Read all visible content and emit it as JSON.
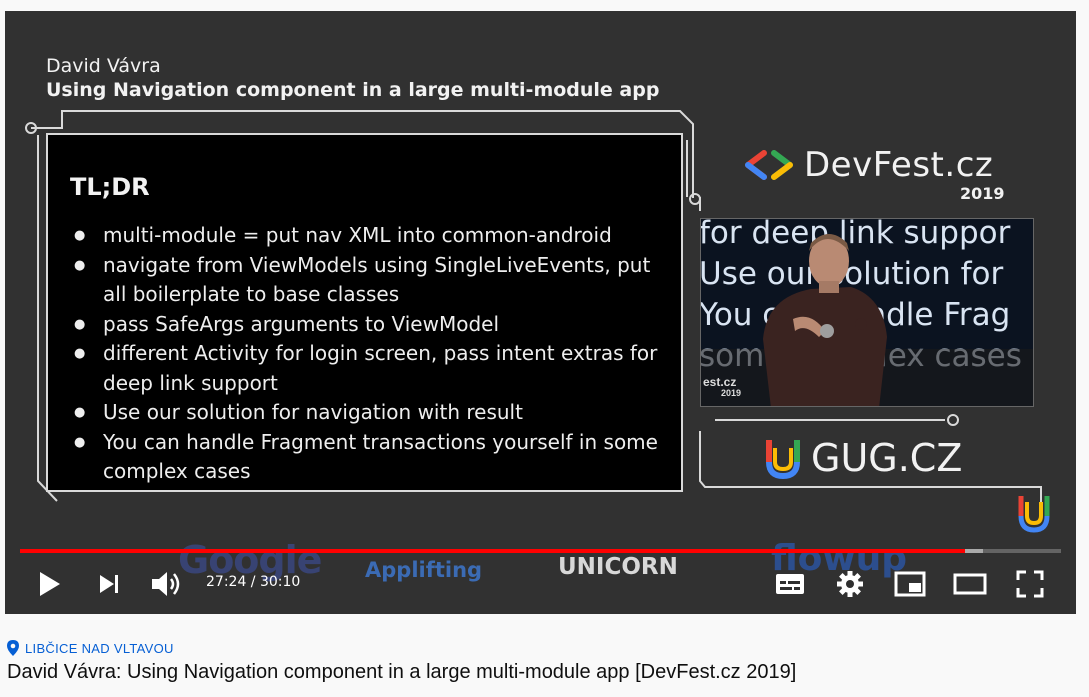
{
  "slide": {
    "speaker": "David Vávra",
    "title": "Using Navigation component in a large multi-module app",
    "tldr_heading": "TL;DR",
    "tldr_items": [
      "multi-module = put nav XML into common-android",
      "navigate from ViewModels using SingleLiveEvents, put all boilerplate to base classes",
      "pass SafeArgs arguments to ViewModel",
      "different Activity for login screen, pass intent extras for deep link support",
      "Use our solution for navigation with result",
      "You can handle Fragment transactions yourself in some complex cases"
    ],
    "devfest_name": "DevFest.cz",
    "devfest_year": "2019",
    "camera_lines": [
      "for deep link suppor",
      "Use our solution for",
      "You can handle Frag",
      "some complex cases"
    ],
    "camera_brand_line1": "est.cz",
    "camera_brand_line2": "2019",
    "gug_name": "GUG.CZ",
    "sponsors": {
      "google": "Google",
      "applifting": "Applifting",
      "unicorn": "UNICORN",
      "flowup": "flowup"
    }
  },
  "player": {
    "current_time": "27:24",
    "duration": "30:10",
    "time_display": "27:24 / 30:10",
    "progress_fraction": 0.908,
    "buffered_fraction": 0.925,
    "controls": [
      "play-icon",
      "next-icon",
      "volume-icon",
      "subtitles-icon",
      "settings-icon",
      "miniplayer-icon",
      "theater-icon",
      "fullscreen-icon"
    ]
  },
  "video": {
    "location": "LIBČICE NAD VLTAVOU",
    "title": "David Vávra: Using Navigation component in a large multi-module app [DevFest.cz 2019]"
  },
  "colors": {
    "progress": "#ff0000",
    "location_link": "#065fd4",
    "slide_bg": "#313131"
  }
}
